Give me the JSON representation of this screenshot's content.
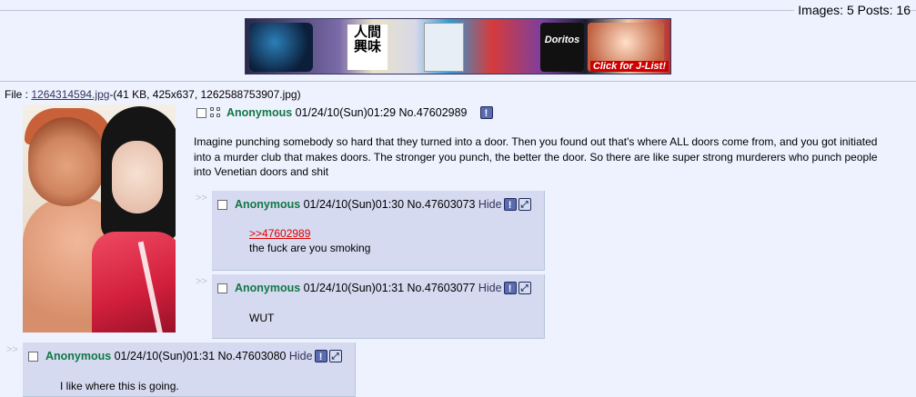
{
  "stats": "Images: 5 Posts: 16",
  "banner": {
    "text_jp": "人間興味",
    "doritos": "Doritos",
    "cta": "Click for J-List!"
  },
  "file": {
    "prefix": "File : ",
    "name": "1264314594.jpg",
    "details": "-(41 KB, 425x637, 1262588753907.jpg)"
  },
  "op": {
    "name": "Anonymous",
    "date": "01/24/10(Sun)01:29",
    "no": "No.47602989",
    "text": "Imagine punching somebody so hard that they turned into a door. Then you found out that's where ALL doors come from, and you got initiated into a murder club that makes doors. The stronger you punch, the better the door. So there are like super strong murderers who punch people into Venetian doors and shit"
  },
  "arrows": ">>",
  "replies": [
    {
      "name": "Anonymous",
      "date": "01/24/10(Sun)01:30",
      "no": "No.47603073",
      "hide": "Hide",
      "quote": ">>47602989",
      "text": "the fuck are you smoking"
    },
    {
      "name": "Anonymous",
      "date": "01/24/10(Sun)01:31",
      "no": "No.47603077",
      "hide": "Hide",
      "text": "WUT"
    },
    {
      "name": "Anonymous",
      "date": "01/24/10(Sun)01:31",
      "no": "No.47603080",
      "hide": "Hide",
      "text": "I like where this is going."
    }
  ],
  "icons": {
    "report": "report-icon",
    "expand": "expand-icon",
    "oekaki": "oekaki-icon"
  }
}
